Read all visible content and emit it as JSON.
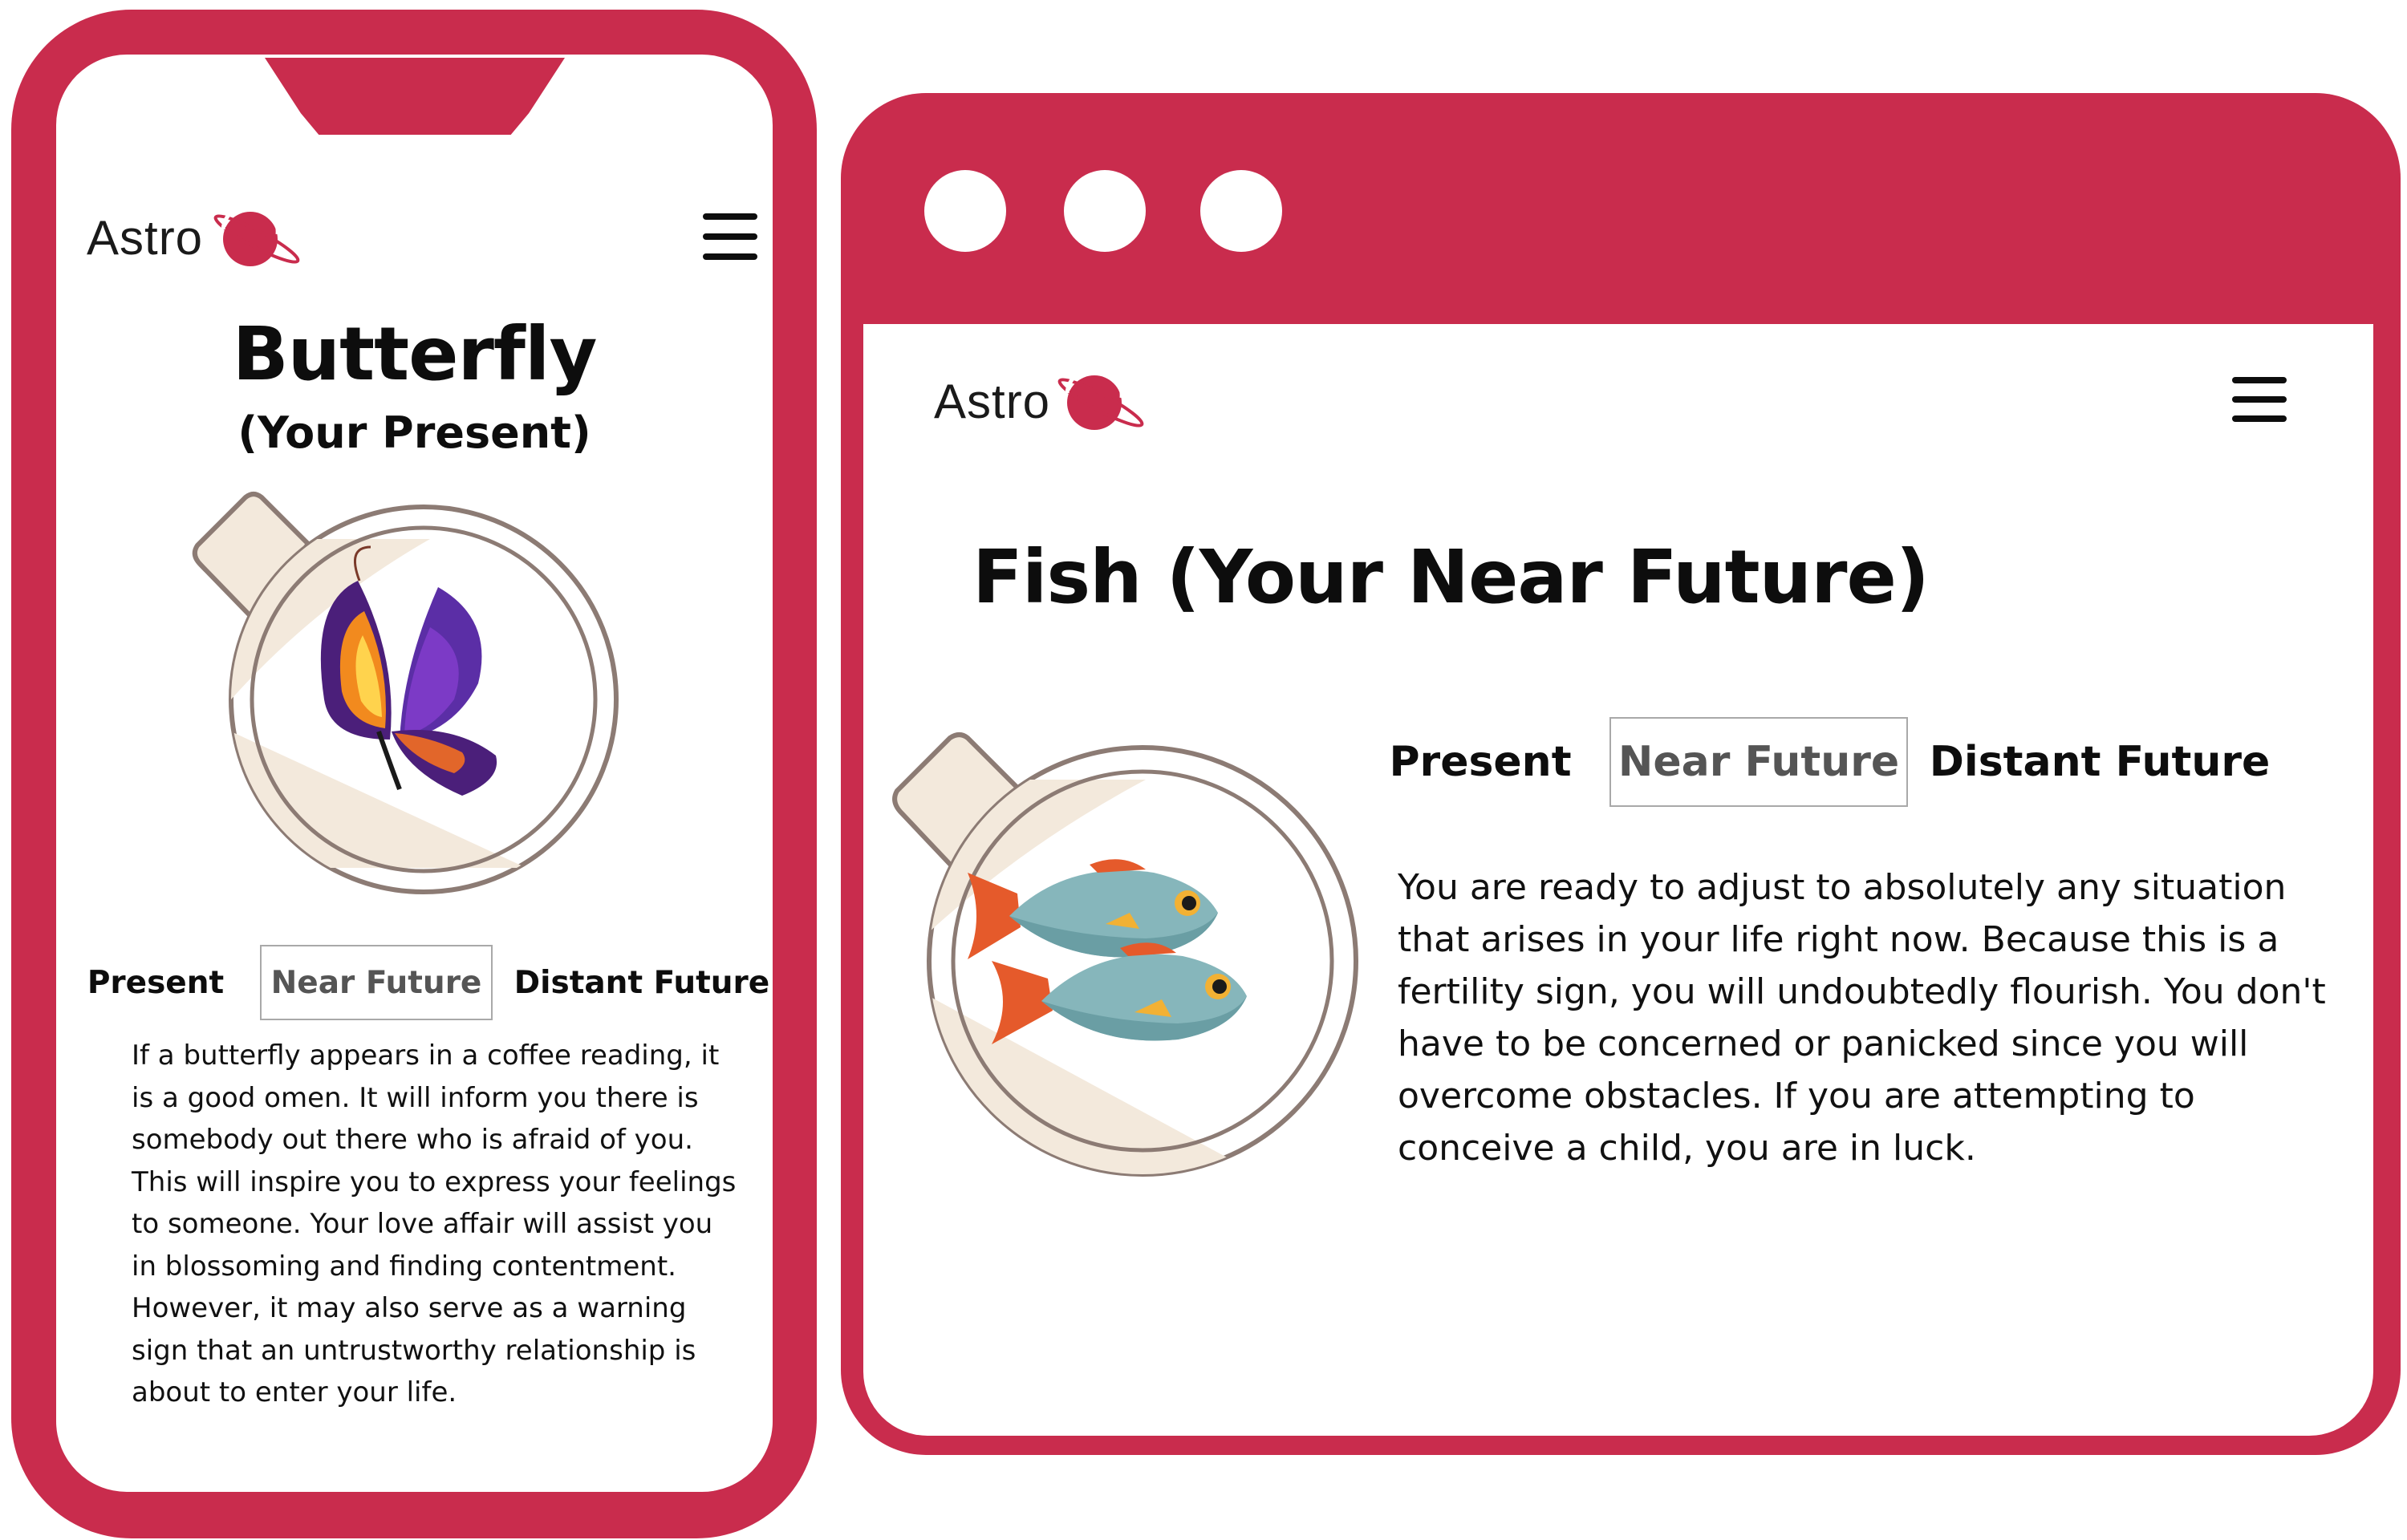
{
  "colors": {
    "brand": "#c92c4d",
    "cup_fill": "#f3e9dc",
    "cup_rim": "#8c7b74"
  },
  "logo": {
    "text": "Astro"
  },
  "mobile": {
    "title": "Butterfly",
    "subtitle": "(Your Present)",
    "tabs": [
      "Present",
      "Near Future",
      "Distant Future"
    ],
    "active_tab": "Near Future",
    "body": "If a butterfly appears in a coffee reading, it is a good omen. It will inform you there is somebody out there who is afraid of you. This will inspire you to express your feelings to someone. Your love affair will assist you in blossoming and finding contentment. However, it may also serve as a warning sign that an untrustworthy relationship is about to enter your life.",
    "illustration": "butterfly-in-coffee-cup"
  },
  "desktop": {
    "title": "Fish (Your Near Future)",
    "tabs": [
      "Present",
      "Near Future",
      "Distant Future"
    ],
    "active_tab": "Near Future",
    "body": "You are ready to adjust to absolutely any situation that arises in your life right now. Because this is a fertility sign, you will undoubtedly flourish. You don't have to be concerned or panicked since you will overcome obstacles. If you are attempting to conceive a child, you are in luck.",
    "illustration": "two-fish-in-coffee-cup"
  },
  "icons": [
    "planet-logo-icon",
    "hamburger-menu-icon",
    "window-dot-icon"
  ]
}
